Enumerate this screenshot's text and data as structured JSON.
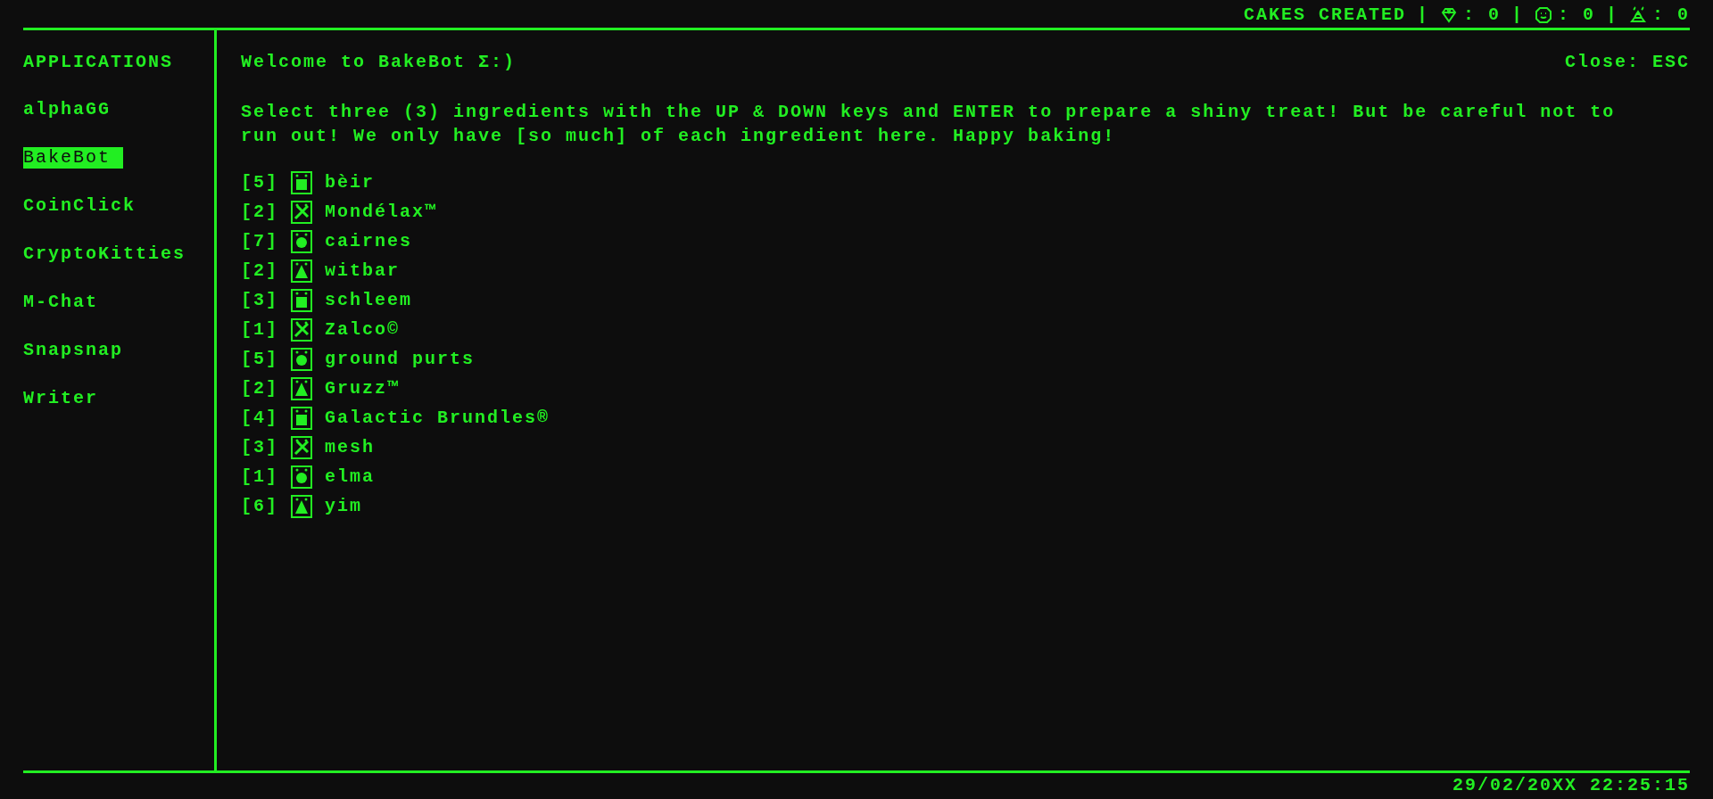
{
  "status_bar": {
    "label": "CAKES CREATED",
    "separator": "|",
    "counters": [
      {
        "value": ": 0"
      },
      {
        "value": ": 0"
      },
      {
        "value": ": 0"
      }
    ]
  },
  "sidebar": {
    "title": "APPLICATIONS",
    "items": [
      {
        "label": "alphaGG",
        "selected": false
      },
      {
        "label": "BakeBot",
        "selected": true
      },
      {
        "label": "CoinClick",
        "selected": false
      },
      {
        "label": "CryptoKitties",
        "selected": false
      },
      {
        "label": "M-Chat",
        "selected": false
      },
      {
        "label": "Snapsnap",
        "selected": false
      },
      {
        "label": "Writer",
        "selected": false
      }
    ]
  },
  "content": {
    "title": "Welcome to BakeBot Σ:)",
    "close_hint": "Close: ESC",
    "instructions": "Select three (3) ingredients with the UP & DOWN keys and ENTER to prepare a shiny treat! But be careful not to run out! We only have [so much] of each ingredient here. Happy baking!",
    "ingredients": [
      {
        "count": "[5]",
        "name": "bèir"
      },
      {
        "count": "[2]",
        "name": "Mondélax™"
      },
      {
        "count": "[7]",
        "name": "cairnes"
      },
      {
        "count": "[2]",
        "name": "witbar"
      },
      {
        "count": "[3]",
        "name": "schleem"
      },
      {
        "count": "[1]",
        "name": "Zalco©"
      },
      {
        "count": "[5]",
        "name": "ground purts"
      },
      {
        "count": "[2]",
        "name": "Gruzz™"
      },
      {
        "count": "[4]",
        "name": "Galactic Brundles®"
      },
      {
        "count": "[3]",
        "name": "mesh"
      },
      {
        "count": "[1]",
        "name": "elma"
      },
      {
        "count": "[6]",
        "name": "yim"
      }
    ]
  },
  "footer": {
    "datetime": "29/02/20XX 22:25:15"
  }
}
